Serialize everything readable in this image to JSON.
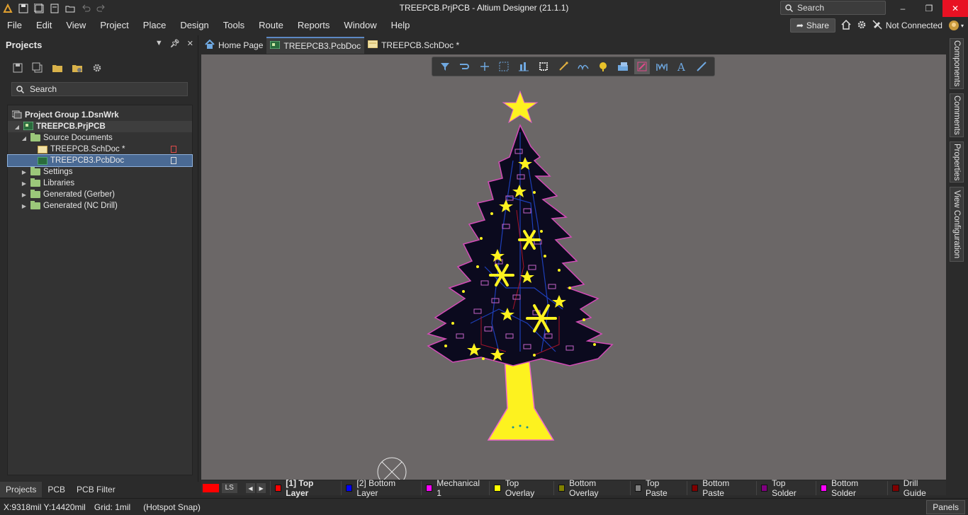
{
  "window": {
    "title": "TREEPCB.PrjPCB - Altium Designer (21.1.1)",
    "search_placeholder": "Search",
    "minimize_icon": "minimize-icon",
    "maximize_icon": "restore-icon",
    "close_icon": "close-icon"
  },
  "menubar": {
    "items": [
      "File",
      "Edit",
      "View",
      "Project",
      "Place",
      "Design",
      "Tools",
      "Route",
      "Reports",
      "Window",
      "Help"
    ],
    "share_label": "Share",
    "connection_status": "Not Connected"
  },
  "projects_panel": {
    "title": "Projects",
    "search_placeholder": "Search",
    "tree": {
      "group": "Project Group 1.DsnWrk",
      "project": "TREEPCB.PrjPCB",
      "source_documents": "Source Documents",
      "files": [
        "TREEPCB.SchDoc *",
        "TREEPCB3.PcbDoc"
      ],
      "folders": [
        "Settings",
        "Libraries",
        "Generated (Gerber)",
        "Generated (NC Drill)"
      ]
    },
    "bottom_tabs": [
      "Projects",
      "PCB",
      "PCB Filter"
    ]
  },
  "doc_tabs": [
    "Home Page",
    "TREEPCB3.PcbDoc",
    "TREEPCB.SchDoc *"
  ],
  "right_dock": [
    "Components",
    "Comments",
    "Properties",
    "View Configuration"
  ],
  "layers": {
    "ls_label": "LS",
    "items": [
      {
        "name": "[1] Top Layer",
        "color": "#ff0000"
      },
      {
        "name": "[2] Bottom Layer",
        "color": "#0000ff"
      },
      {
        "name": "Mechanical 1",
        "color": "#ff00ff"
      },
      {
        "name": "Top Overlay",
        "color": "#ffff00"
      },
      {
        "name": "Bottom Overlay",
        "color": "#808000"
      },
      {
        "name": "Top Paste",
        "color": "#808080"
      },
      {
        "name": "Bottom Paste",
        "color": "#800000"
      },
      {
        "name": "Top Solder",
        "color": "#800080"
      },
      {
        "name": "Bottom Solder",
        "color": "#ff00ff"
      },
      {
        "name": "Drill Guide",
        "color": "#800000"
      }
    ]
  },
  "status": {
    "coords": "X:9318mil Y:14420mil",
    "grid": "Grid: 1mil",
    "snap": "(Hotspot Snap)",
    "panels_label": "Panels"
  }
}
